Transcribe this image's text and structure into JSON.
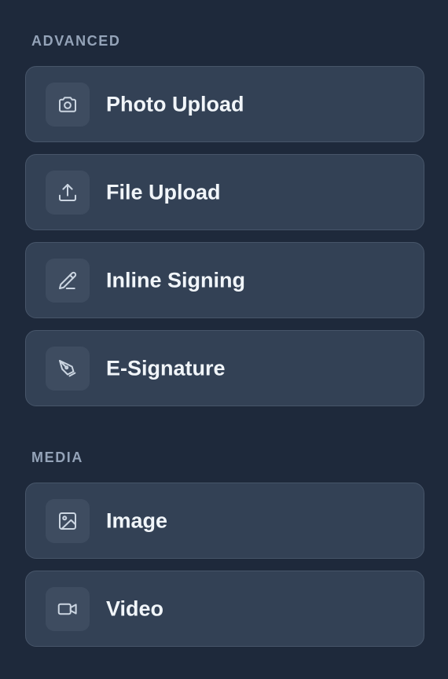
{
  "sections": [
    {
      "title": "ADVANCED",
      "items": [
        {
          "label": "Photo Upload",
          "icon": "camera-icon"
        },
        {
          "label": "File Upload",
          "icon": "upload-icon"
        },
        {
          "label": "Inline Signing",
          "icon": "pencil-icon"
        },
        {
          "label": "E-Signature",
          "icon": "pen-nib-icon"
        }
      ]
    },
    {
      "title": "MEDIA",
      "items": [
        {
          "label": "Image",
          "icon": "image-icon"
        },
        {
          "label": "Video",
          "icon": "video-camera-icon"
        }
      ]
    }
  ],
  "colors": {
    "background": "#1e293b",
    "card": "#334155",
    "card_border": "#475569",
    "icon_box": "#3e4c60",
    "section_title": "#94a3b8",
    "label": "#f1f5f9",
    "icon_stroke": "#cbd5e1"
  }
}
